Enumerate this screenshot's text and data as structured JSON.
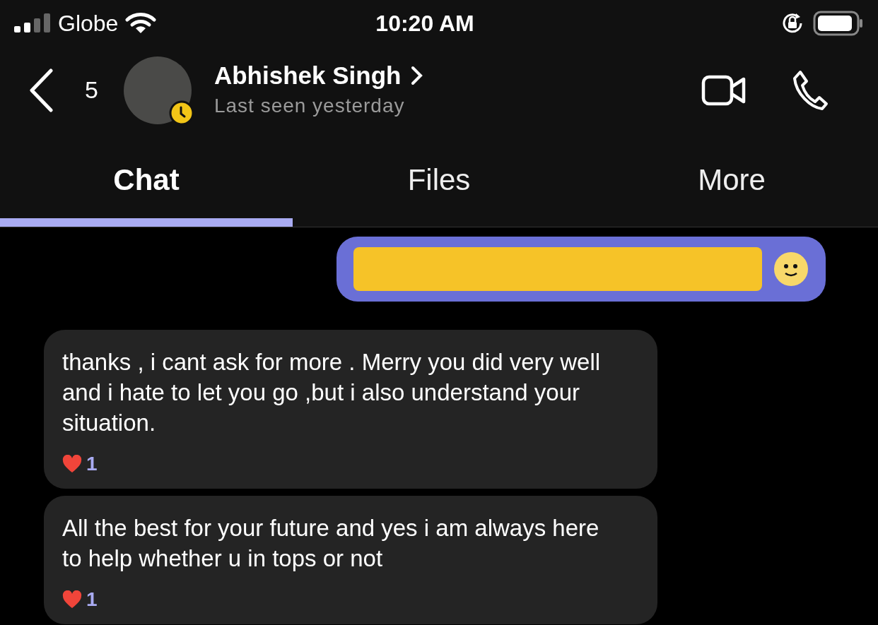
{
  "status_bar": {
    "carrier": "Globe",
    "time": "10:20 AM"
  },
  "header": {
    "unread_count": "5",
    "name": "Abhishek Singh",
    "status": "Last seen yesterday"
  },
  "tabs": [
    {
      "label": "Chat",
      "selected": true
    },
    {
      "label": "Files",
      "selected": false
    },
    {
      "label": "More",
      "selected": false
    }
  ],
  "messages": [
    {
      "kind": "outgoing",
      "redacted": true
    },
    {
      "kind": "incoming",
      "text": "thanks , i cant ask for more . Merry you did very well and i hate to let you go ,but i also understand your situation.",
      "reaction_count": "1"
    },
    {
      "kind": "incoming",
      "text": "All the best for your future and yes i am always here to help whether u in tops or not",
      "reaction_count": "1"
    }
  ]
}
